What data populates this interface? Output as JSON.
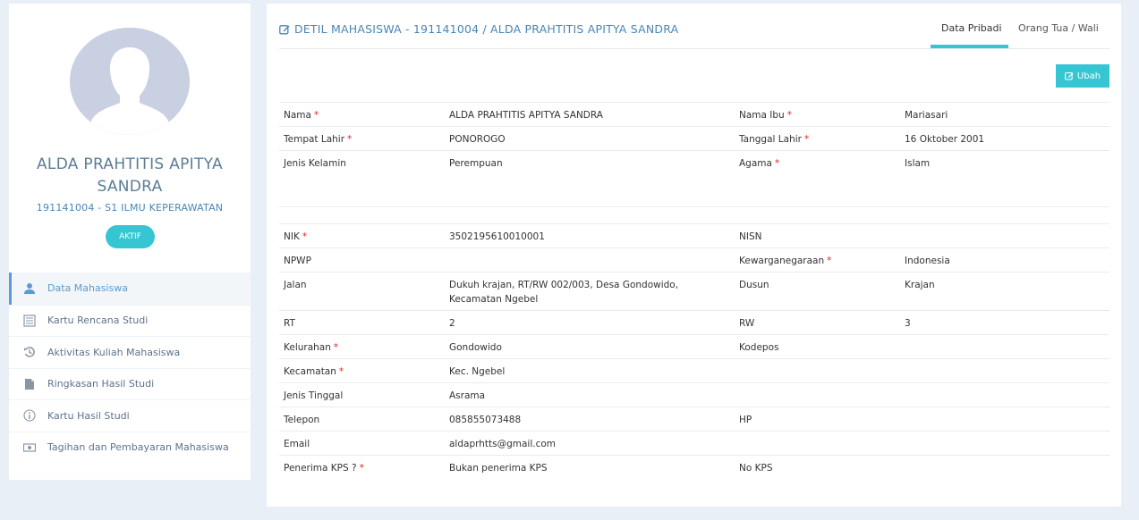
{
  "profile": {
    "name": "ALDA PRAHTITIS APITYA SANDRA",
    "id_line": "191141004 - S1 ILMU KEPERAWATAN",
    "status": "AKTIF"
  },
  "menu": [
    {
      "label": "Data Mahasiswa",
      "icon": "user-icon"
    },
    {
      "label": "Kartu Rencana Studi",
      "icon": "list-icon"
    },
    {
      "label": "Aktivitas Kuliah Mahasiswa",
      "icon": "history-icon"
    },
    {
      "label": "Ringkasan Hasil Studi",
      "icon": "file-icon"
    },
    {
      "label": "Kartu Hasil Studi",
      "icon": "info-icon"
    },
    {
      "label": "Tagihan dan Pembayaran Mahasiswa",
      "icon": "money-icon"
    }
  ],
  "detail": {
    "title": "DETIL MAHASISWA - 191141004 / ALDA PRAHTITIS APITYA SANDRA",
    "tabs": [
      "Data Pribadi",
      "Orang Tua / Wali"
    ],
    "edit_button": "Ubah"
  },
  "section1": [
    {
      "l1": "Nama",
      "r1": true,
      "v1": "ALDA PRAHTITIS APITYA SANDRA",
      "l2": "Nama Ibu",
      "r2": true,
      "v2": "Mariasari"
    },
    {
      "l1": "Tempat Lahir",
      "r1": true,
      "v1": "PONOROGO",
      "l2": "Tanggal Lahir",
      "r2": true,
      "v2": "16 Oktober 2001"
    },
    {
      "l1": "Jenis Kelamin",
      "r1": false,
      "v1": "Perempuan",
      "l2": "Agama",
      "r2": true,
      "v2": "Islam"
    }
  ],
  "section2": [
    {
      "l1": "NIK",
      "r1": true,
      "v1": "3502195610010001",
      "l2": "NISN",
      "r2": false,
      "v2": ""
    },
    {
      "l1": "NPWP",
      "r1": false,
      "v1": "",
      "l2": "Kewarganegaraan",
      "r2": true,
      "v2": "Indonesia"
    },
    {
      "l1": "Jalan",
      "r1": false,
      "v1": "Dukuh krajan, RT/RW 002/003, Desa Gondowido, Kecamatan Ngebel",
      "l2": "Dusun",
      "r2": false,
      "v2": "Krajan"
    },
    {
      "l1": "RT",
      "r1": false,
      "v1": "2",
      "l2": "RW",
      "r2": false,
      "v2": "3"
    },
    {
      "l1": "Kelurahan",
      "r1": true,
      "v1": "Gondowido",
      "l2": "Kodepos",
      "r2": false,
      "v2": ""
    },
    {
      "l1": "Kecamatan",
      "r1": true,
      "v1": "Kec. Ngebel",
      "l2": "",
      "r2": false,
      "v2": ""
    },
    {
      "l1": "Jenis Tinggal",
      "r1": false,
      "v1": "Asrama",
      "l2": "",
      "r2": false,
      "v2": ""
    },
    {
      "l1": "Telepon",
      "r1": false,
      "v1": "085855073488",
      "l2": "HP",
      "r2": false,
      "v2": ""
    },
    {
      "l1": "Email",
      "r1": false,
      "v1": "aldaprhtts@gmail.com",
      "l2": "",
      "r2": false,
      "v2": ""
    },
    {
      "l1": "Penerima KPS ?",
      "r1": true,
      "v1": "Bukan penerima KPS",
      "l2": "No KPS",
      "r2": false,
      "v2": ""
    }
  ],
  "required_mark": "*",
  "colors": {
    "accent": "#36c6d3",
    "link": "#4a86b5",
    "required": "#e02222"
  }
}
